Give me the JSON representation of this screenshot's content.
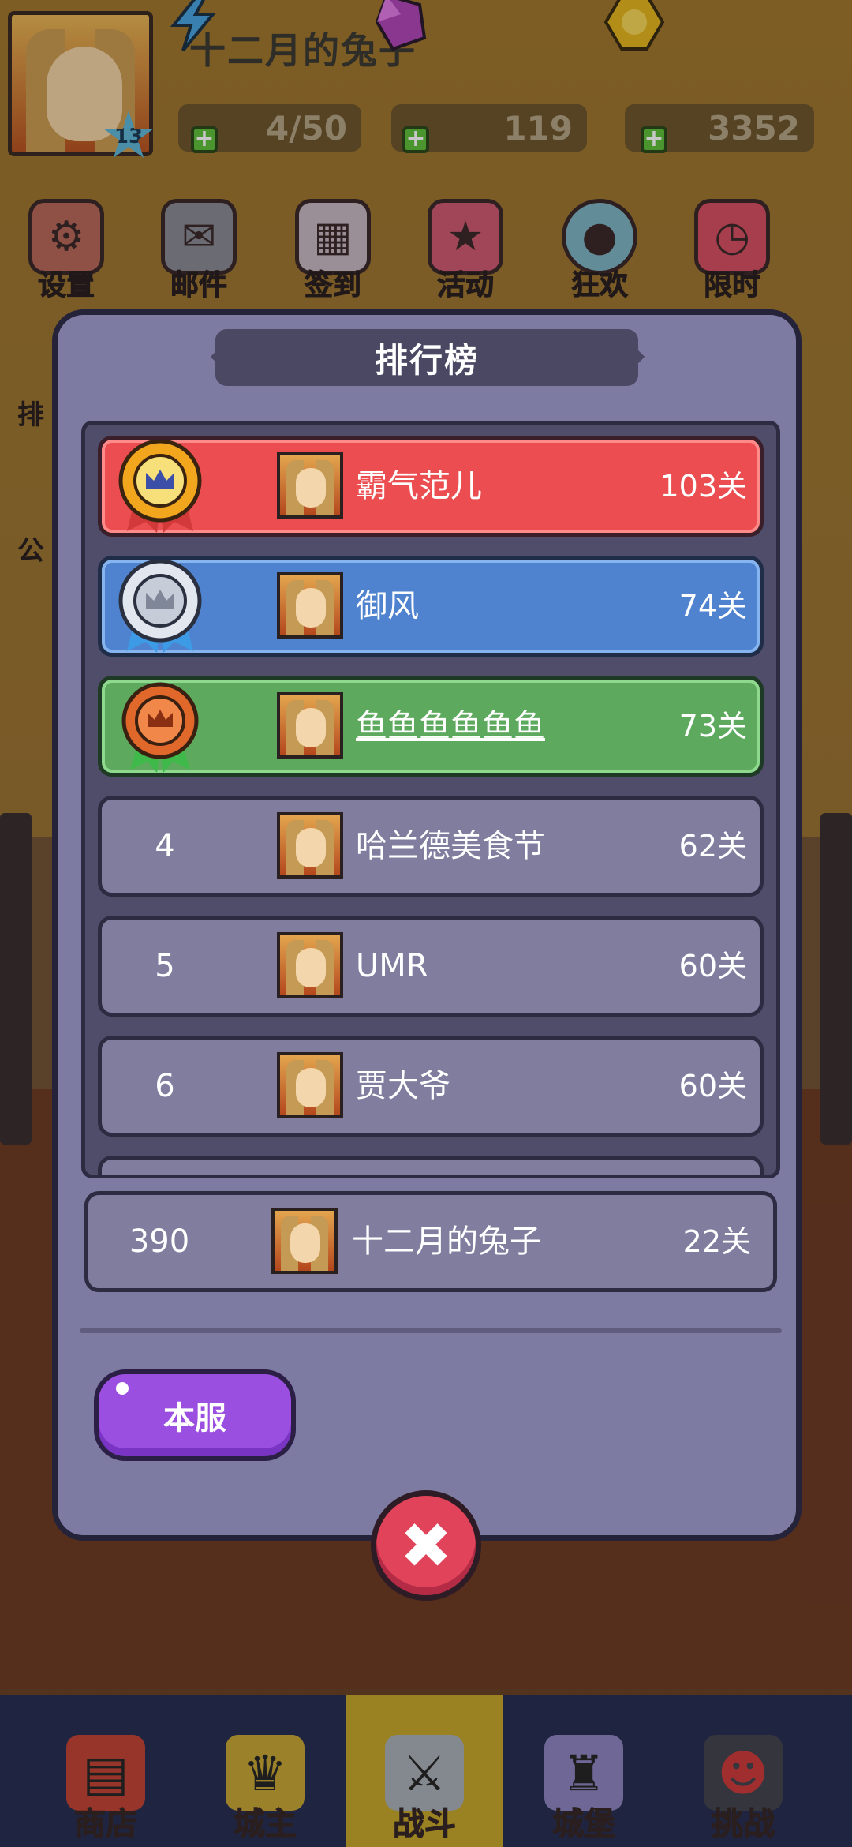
{
  "player": {
    "name": "十二月的兔子",
    "level": "13"
  },
  "resources": {
    "energy": "4/50",
    "gems": "119",
    "gold": "3352"
  },
  "top_menu": [
    {
      "label": "设置",
      "icon": "gear-icon"
    },
    {
      "label": "邮件",
      "icon": "mail-icon"
    },
    {
      "label": "签到",
      "icon": "calendar-icon"
    },
    {
      "label": "活动",
      "icon": "gift-star-icon"
    },
    {
      "label": "狂欢",
      "icon": "balloons-icon"
    },
    {
      "label": "限时",
      "icon": "clock-gift-icon"
    }
  ],
  "side_labels": [
    "排",
    "公"
  ],
  "leaderboard": {
    "title": "排行榜",
    "rows": [
      {
        "rank": "1",
        "name": "霸气范儿",
        "score": "103关",
        "medal": "gold-medal-icon"
      },
      {
        "rank": "2",
        "name": "御风",
        "score": "74关",
        "medal": "silver-medal-icon"
      },
      {
        "rank": "3",
        "name": "鱼鱼鱼鱼鱼鱼",
        "score": "73关",
        "medal": "bronze-medal-icon"
      },
      {
        "rank": "4",
        "name": "哈兰德美食节",
        "score": "62关"
      },
      {
        "rank": "5",
        "name": "UMR",
        "score": "60关"
      },
      {
        "rank": "6",
        "name": "贾大爷",
        "score": "60关"
      }
    ],
    "self": {
      "rank": "390",
      "name": "十二月的兔子",
      "score": "22关"
    },
    "server_button": "本服",
    "close_icon": "close-icon"
  },
  "bottom_nav": [
    {
      "label": "商店",
      "icon": "shop-icon"
    },
    {
      "label": "城主",
      "icon": "crown-icon"
    },
    {
      "label": "战斗",
      "icon": "crossed-swords-icon",
      "active": true
    },
    {
      "label": "城堡",
      "icon": "castle-icon"
    },
    {
      "label": "挑战",
      "icon": "demon-icon"
    }
  ],
  "colors": {
    "gold_row": "#eb4d50",
    "silver_row": "#4f83cf",
    "bronze_row": "#5daa5e",
    "default_row": "#807d9f",
    "modal_bg": "#7e7ba2",
    "server_button": "#9b4fe0",
    "close_button": "#e0435a"
  }
}
